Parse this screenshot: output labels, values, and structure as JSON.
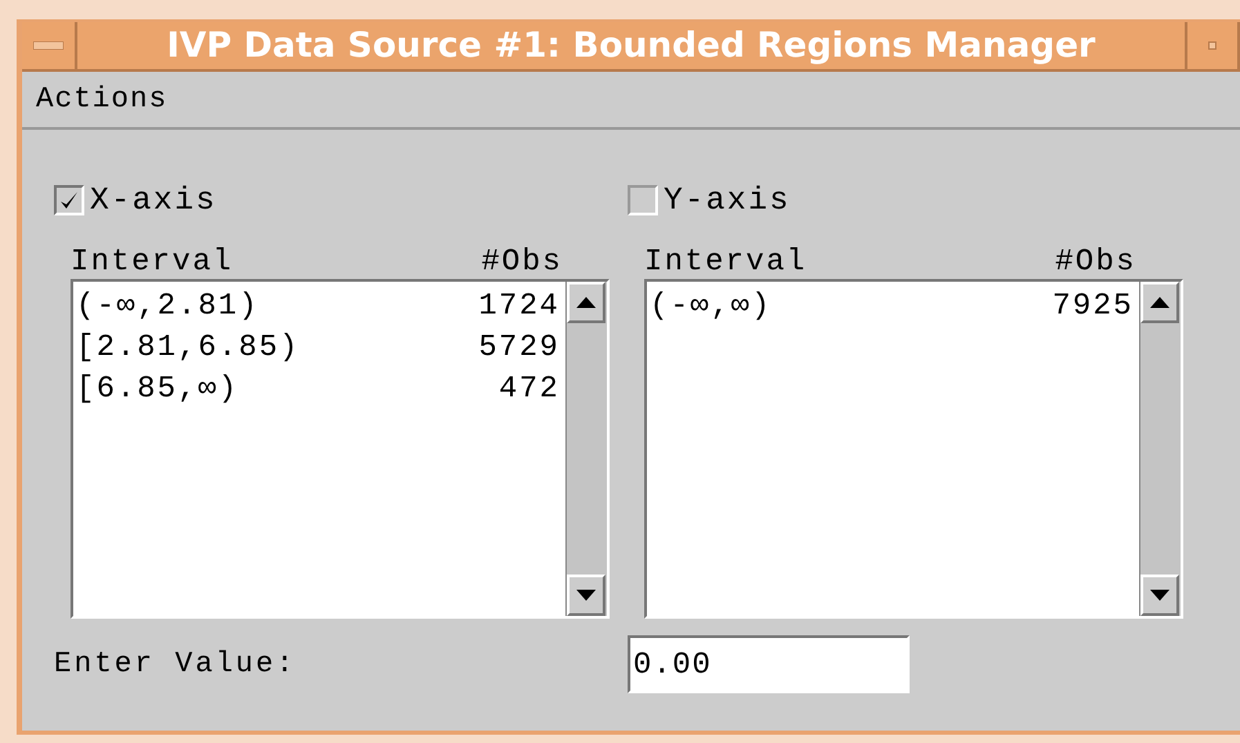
{
  "window": {
    "title": "IVP Data Source #1: Bounded Regions Manager"
  },
  "menu": [
    "Actions"
  ],
  "panels": [
    {
      "label": "X-axis",
      "checked": true,
      "columns": [
        "Interval",
        "#Obs"
      ],
      "rows": [
        {
          "interval": "(-∞,2.81)",
          "obs": "1724"
        },
        {
          "interval": "[2.81,6.85)",
          "obs": "5729"
        },
        {
          "interval": "[6.85,∞)",
          "obs": "472"
        }
      ]
    },
    {
      "label": "Y-axis",
      "checked": false,
      "columns": [
        "Interval",
        "#Obs"
      ],
      "rows": [
        {
          "interval": "(-∞,∞)",
          "obs": "7925"
        }
      ]
    }
  ],
  "enter_value": {
    "label": "Enter Value:",
    "value": "0.00"
  }
}
